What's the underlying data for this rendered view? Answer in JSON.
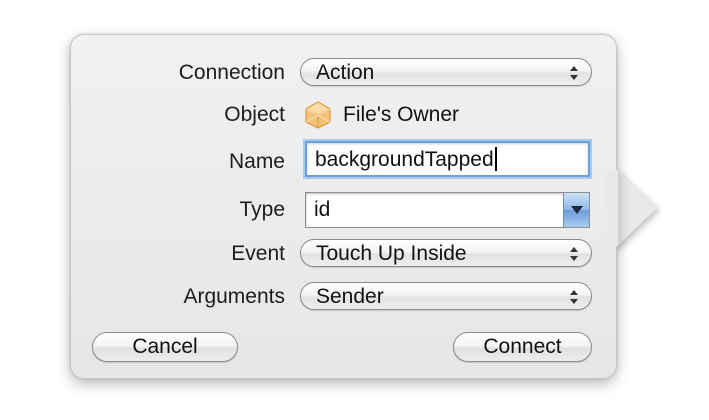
{
  "dialog": {
    "fields": {
      "connection": {
        "label": "Connection",
        "value": "Action"
      },
      "object": {
        "label": "Object",
        "value": "File's Owner",
        "icon": "cube-icon"
      },
      "name": {
        "label": "Name",
        "value": "backgroundTapped"
      },
      "type": {
        "label": "Type",
        "value": "id"
      },
      "event": {
        "label": "Event",
        "value": "Touch Up Inside"
      },
      "arguments": {
        "label": "Arguments",
        "value": "Sender"
      }
    },
    "buttons": {
      "cancel": "Cancel",
      "connect": "Connect"
    }
  },
  "colors": {
    "panel": "#e9e9e9",
    "focus_ring": "#6d9fd8",
    "combo_button": "#8db6e6",
    "cube_icon": "#f0b05a"
  }
}
